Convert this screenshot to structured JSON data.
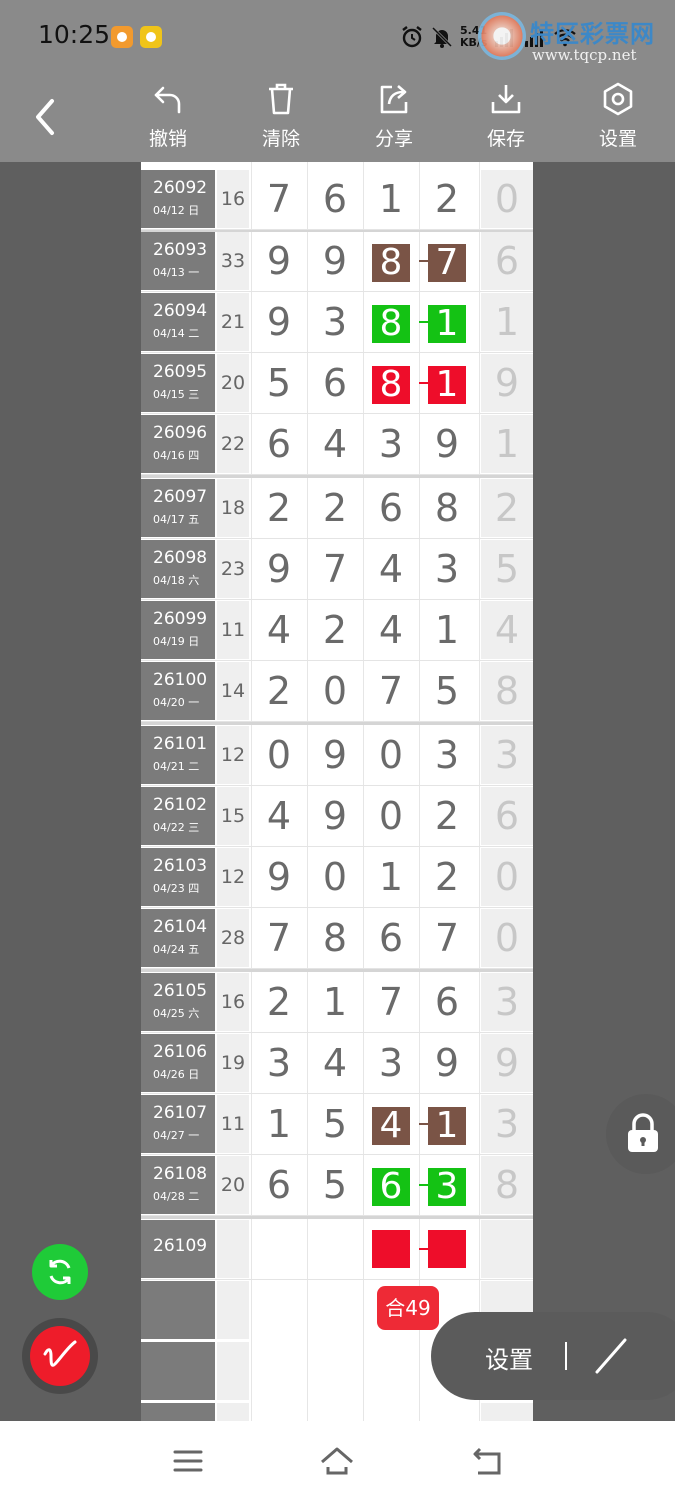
{
  "status": {
    "time": "10:25",
    "net_speed_value": "5.41",
    "net_speed_unit": "KB/s",
    "signal1": "5G",
    "signal2": "5G"
  },
  "watermark": {
    "title": "特区彩票网",
    "url": "www.tqcp.net"
  },
  "toolbar": {
    "undo": "撤销",
    "clear": "清除",
    "share": "分享",
    "save": "保存",
    "settings": "设置"
  },
  "rows": [
    {
      "period": "26092",
      "date": "04/12 日",
      "sum": "16",
      "digits": [
        "7",
        "6",
        "1",
        "2"
      ],
      "last": "0",
      "hl": null
    },
    {
      "period": "26093",
      "date": "04/13 一",
      "sum": "33",
      "digits": [
        "9",
        "9",
        "8",
        "7"
      ],
      "last": "6",
      "hl": "brown"
    },
    {
      "period": "26094",
      "date": "04/14 二",
      "sum": "21",
      "digits": [
        "9",
        "3",
        "8",
        "1"
      ],
      "last": "1",
      "hl": "green"
    },
    {
      "period": "26095",
      "date": "04/15 三",
      "sum": "20",
      "digits": [
        "5",
        "6",
        "8",
        "1"
      ],
      "last": "9",
      "hl": "red"
    },
    {
      "period": "26096",
      "date": "04/16 四",
      "sum": "22",
      "digits": [
        "6",
        "4",
        "3",
        "9"
      ],
      "last": "1",
      "hl": null
    },
    {
      "period": "26097",
      "date": "04/17 五",
      "sum": "18",
      "digits": [
        "2",
        "2",
        "6",
        "8"
      ],
      "last": "2",
      "hl": null
    },
    {
      "period": "26098",
      "date": "04/18 六",
      "sum": "23",
      "digits": [
        "9",
        "7",
        "4",
        "3"
      ],
      "last": "5",
      "hl": null
    },
    {
      "period": "26099",
      "date": "04/19 日",
      "sum": "11",
      "digits": [
        "4",
        "2",
        "4",
        "1"
      ],
      "last": "4",
      "hl": null
    },
    {
      "period": "26100",
      "date": "04/20 一",
      "sum": "14",
      "digits": [
        "2",
        "0",
        "7",
        "5"
      ],
      "last": "8",
      "hl": null
    },
    {
      "period": "26101",
      "date": "04/21 二",
      "sum": "12",
      "digits": [
        "0",
        "9",
        "0",
        "3"
      ],
      "last": "3",
      "hl": null
    },
    {
      "period": "26102",
      "date": "04/22 三",
      "sum": "15",
      "digits": [
        "4",
        "9",
        "0",
        "2"
      ],
      "last": "6",
      "hl": null
    },
    {
      "period": "26103",
      "date": "04/23 四",
      "sum": "12",
      "digits": [
        "9",
        "0",
        "1",
        "2"
      ],
      "last": "0",
      "hl": null
    },
    {
      "period": "26104",
      "date": "04/24 五",
      "sum": "28",
      "digits": [
        "7",
        "8",
        "6",
        "7"
      ],
      "last": "0",
      "hl": null
    },
    {
      "period": "26105",
      "date": "04/25 六",
      "sum": "16",
      "digits": [
        "2",
        "1",
        "7",
        "6"
      ],
      "last": "3",
      "hl": null
    },
    {
      "period": "26106",
      "date": "04/26 日",
      "sum": "19",
      "digits": [
        "3",
        "4",
        "3",
        "9"
      ],
      "last": "9",
      "hl": null
    },
    {
      "period": "26107",
      "date": "04/27 一",
      "sum": "11",
      "digits": [
        "1",
        "5",
        "4",
        "1"
      ],
      "last": "3",
      "hl": "brown"
    },
    {
      "period": "26108",
      "date": "04/28 二",
      "sum": "20",
      "digits": [
        "6",
        "5",
        "6",
        "3"
      ],
      "last": "8",
      "hl": "green"
    },
    {
      "period": "26109",
      "date": "",
      "sum": "",
      "digits": [
        "",
        "",
        "",
        ""
      ],
      "last": "",
      "hl": "red-empty"
    }
  ],
  "colors": {
    "brown": "#7a5446",
    "green": "#14c214",
    "red": "#ee0d2a"
  },
  "sum_tag": "合49",
  "pill": {
    "label": "设置"
  }
}
